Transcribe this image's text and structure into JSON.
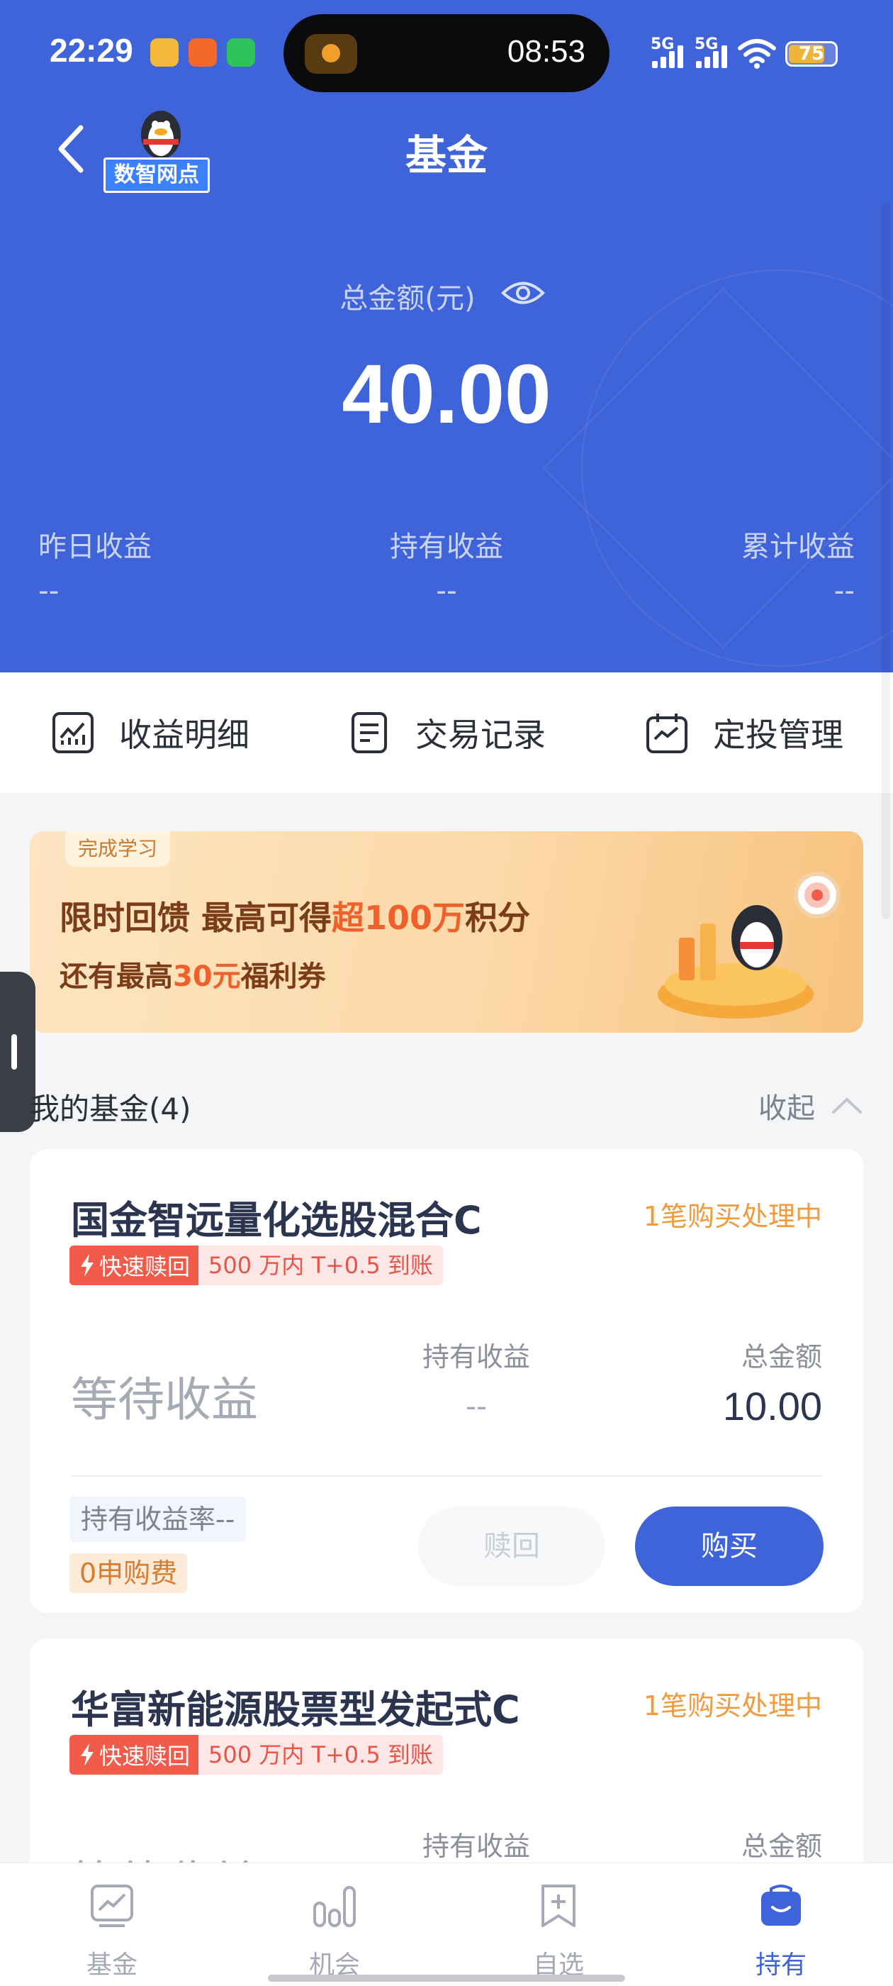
{
  "status_bar": {
    "time": "22:29",
    "island_time": "08:53",
    "signal1": "5G",
    "signal2": "5G",
    "battery": "75"
  },
  "header": {
    "logo_text": "数智网点",
    "title": "基金"
  },
  "summary": {
    "total_label": "总金额(元)",
    "total_value": "40.00",
    "stats": [
      {
        "label": "昨日收益",
        "value": "--"
      },
      {
        "label": "持有收益",
        "value": "--"
      },
      {
        "label": "累计收益",
        "value": "--"
      }
    ]
  },
  "actions": [
    {
      "label": "收益明细",
      "icon": "chart-icon"
    },
    {
      "label": "交易记录",
      "icon": "document-icon"
    },
    {
      "label": "定投管理",
      "icon": "calendar-icon"
    }
  ],
  "banner": {
    "tag": "完成学习",
    "line1_a": "限时回馈  最高可得",
    "line1_hl": "超100万",
    "line1_b": "积分",
    "line2_a": "还有最高",
    "line2_hl": "30元",
    "line2_b": "福利券"
  },
  "section": {
    "title": "我的基金(4)",
    "collapse_label": "收起"
  },
  "funds": [
    {
      "name": "国金智远量化选股混合C",
      "status": "1笔购买处理中",
      "fast_tag": "快速赎回",
      "fast_info": "500 万内 T+0.5 到账",
      "wait_text": "等待收益",
      "hold_label": "持有收益",
      "hold_value": "--",
      "total_label": "总金额",
      "total_value": "10.00",
      "rate_text": "持有收益率--",
      "fee_text": "0申购费",
      "redeem_label": "赎回",
      "buy_label": "购买"
    },
    {
      "name": "华富新能源股票型发起式C",
      "status": "1笔购买处理中",
      "fast_tag": "快速赎回",
      "fast_info": "500 万内 T+0.5 到账",
      "wait_text": "等待收益",
      "hold_label": "持有收益",
      "total_label": "总金额"
    }
  ],
  "tabbar": [
    {
      "label": "基金",
      "icon": "fund-chart-icon",
      "active": false
    },
    {
      "label": "机会",
      "icon": "bar-chart-icon",
      "active": false
    },
    {
      "label": "自选",
      "icon": "bookmark-add-icon",
      "active": false
    },
    {
      "label": "持有",
      "icon": "wallet-bag-icon",
      "active": true
    }
  ],
  "colors": {
    "primary": "#3f63d8",
    "status_orange": "#f29a3c",
    "fast_red": "#f25a4a"
  }
}
